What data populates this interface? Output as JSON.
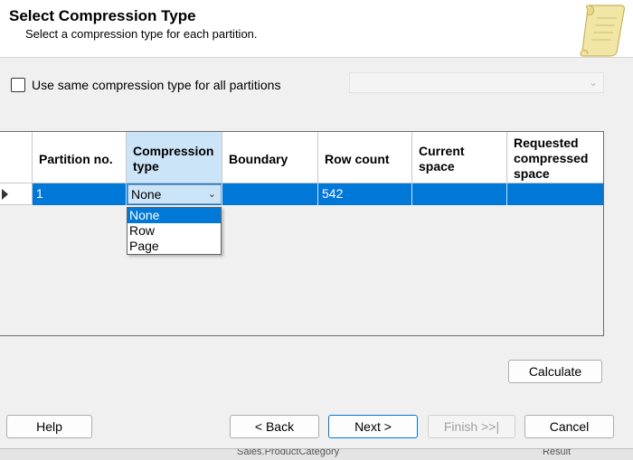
{
  "header": {
    "title": "Select Compression Type",
    "subtitle": "Select a compression type for each partition."
  },
  "options": {
    "same_type_label": "Use same compression type for all partitions",
    "same_type_checked": false
  },
  "grid": {
    "columns": [
      "Partition no.",
      "Compression type",
      "Boundary",
      "Row count",
      "Current space",
      "Requested compressed space"
    ],
    "rows": [
      {
        "partition_no": "1",
        "compression_type": "None",
        "boundary": "",
        "row_count": "542",
        "current_space": "",
        "requested_space": ""
      }
    ]
  },
  "dropdown": {
    "options": [
      "None",
      "Row",
      "Page"
    ],
    "selected": "None"
  },
  "buttons": {
    "calculate": "Calculate",
    "help": "Help",
    "back": "< Back",
    "next": "Next >",
    "finish": "Finish >>|",
    "cancel": "Cancel"
  },
  "taskbar": {
    "text1": "Sales.ProductCategory",
    "text2": "Result"
  },
  "colors": {
    "selection": "#0078d7",
    "selected_header": "#cce4f7"
  }
}
